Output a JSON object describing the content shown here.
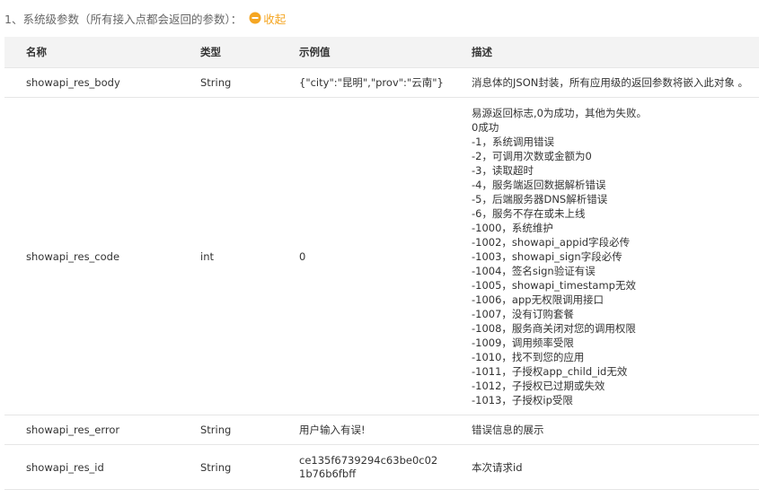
{
  "section": {
    "title": "1、系统级参数（所有接入点都会返回的参数）：",
    "collapse_label": "收起",
    "accent_color": "#f5a623"
  },
  "table": {
    "headers": {
      "name": "名称",
      "type": "类型",
      "example": "示例值",
      "description": "描述"
    },
    "rows": [
      {
        "name": "showapi_res_body",
        "type": "String",
        "example": "{\"city\":\"昆明\",\"prov\":\"云南\"}",
        "description": "消息体的JSON封装，所有应用级的返回参数将嵌入此对象 。"
      },
      {
        "name": "showapi_res_code",
        "type": "int",
        "example": "0",
        "description_lines": [
          "易源返回标志,0为成功，其他为失败。",
          "0成功",
          "-1，系统调用错误",
          "-2，可调用次数或金额为0",
          "-3，读取超时",
          "-4，服务端返回数据解析错误",
          "-5，后端服务器DNS解析错误",
          "-6，服务不存在或未上线",
          "-1000，系统维护",
          "-1002，showapi_appid字段必传",
          "-1003，showapi_sign字段必传",
          "-1004，签名sign验证有误",
          "-1005，showapi_timestamp无效",
          "-1006，app无权限调用接口",
          "-1007，没有订购套餐",
          "-1008，服务商关闭对您的调用权限",
          "-1009，调用频率受限",
          "-1010，找不到您的应用",
          "-1011，子授权app_child_id无效",
          "-1012，子授权已过期或失效",
          "-1013，子授权ip受限"
        ]
      },
      {
        "name": "showapi_res_error",
        "type": "String",
        "example": "用户输入有误!",
        "description": "错误信息的展示"
      },
      {
        "name": "showapi_res_id",
        "type": "String",
        "example_lines": [
          "ce135f6739294c63be0c02",
          "1b76b6fbff"
        ],
        "description": "本次请求id"
      }
    ]
  },
  "icons": {
    "collapse": "minus-circle-icon"
  }
}
